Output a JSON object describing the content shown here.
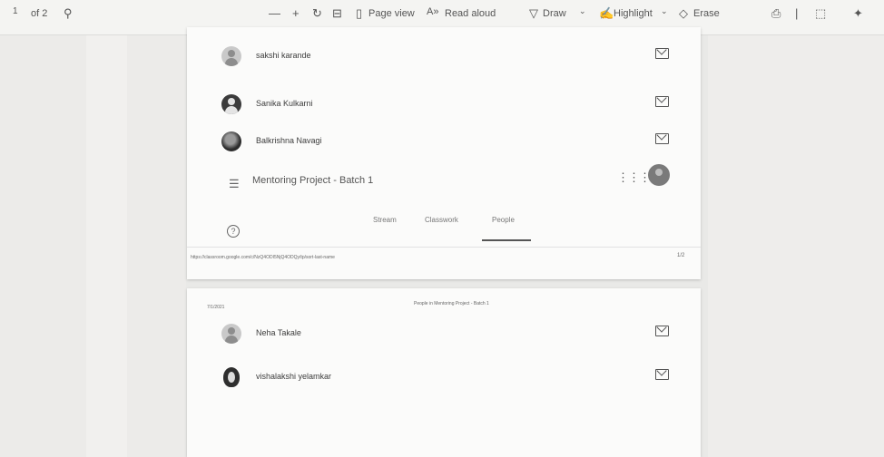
{
  "toolbar": {
    "page_indicator": "of 2",
    "zoom_out": "—",
    "zoom_in": "+",
    "page_view": "Page view",
    "read_aloud": "Read aloud",
    "draw": "Draw",
    "highlight": "Highlight",
    "erase": "Erase"
  },
  "page1": {
    "people": [
      {
        "name": "sakshi karande",
        "avatar": "gray"
      },
      {
        "name": "Sanika Kulkarni",
        "avatar": "dark"
      },
      {
        "name": "Balkrishna Navagi",
        "avatar": "photo"
      }
    ],
    "class_title": "Mentoring Project - Batch 1",
    "tabs": [
      "Stream",
      "Classwork",
      "People"
    ],
    "active_tab": "People",
    "footer_url": "https://classroom.google.com/c/NzQ4ODI5NjQ4ODQy/tp/sort-last-name",
    "footer_page": "1/2"
  },
  "page2": {
    "date": "7/1/2021",
    "header": "People in Mentoring Project - Batch 1",
    "people": [
      {
        "name": "Neha Takale",
        "avatar": "gray"
      },
      {
        "name": "vishalakshi yelamkar",
        "avatar": "oval"
      }
    ]
  }
}
